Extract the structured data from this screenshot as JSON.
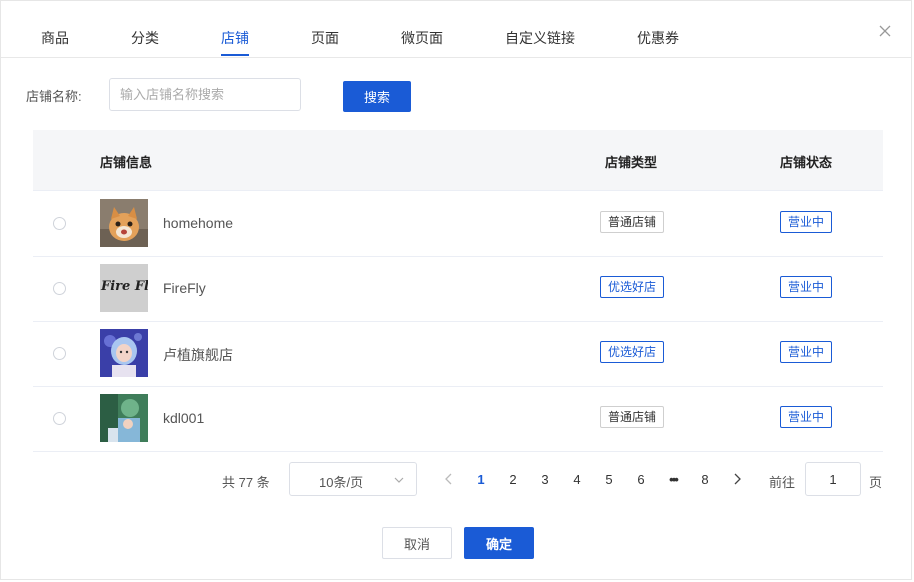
{
  "tabs": [
    {
      "label": "商品",
      "active": false
    },
    {
      "label": "分类",
      "active": false
    },
    {
      "label": "店铺",
      "active": true
    },
    {
      "label": "页面",
      "active": false
    },
    {
      "label": "微页面",
      "active": false
    },
    {
      "label": "自定义链接",
      "active": false
    },
    {
      "label": "优惠券",
      "active": false
    }
  ],
  "search": {
    "label": "店铺名称:",
    "placeholder": "输入店铺名称搜索",
    "value": "",
    "button_label": "搜索"
  },
  "table": {
    "headers": {
      "info": "店铺信息",
      "type": "店铺类型",
      "status": "店铺状态"
    },
    "rows": [
      {
        "name": "homehome",
        "type": "普通店铺",
        "type_kind": "normal",
        "status": "营业中",
        "thumb": "cat-photo"
      },
      {
        "name": "FireFly",
        "type": "优选好店",
        "type_kind": "featured",
        "status": "营业中",
        "thumb": "fire-fly-logo",
        "thumb_text": "Fire Fly"
      },
      {
        "name": "卢植旗舰店",
        "type": "优选好店",
        "type_kind": "featured",
        "status": "营业中",
        "thumb": "person-photo"
      },
      {
        "name": "kdl001",
        "type": "普通店铺",
        "type_kind": "normal",
        "status": "营业中",
        "thumb": "illustration-photo"
      }
    ]
  },
  "pagination": {
    "total_text": "共 77 条",
    "page_size_label": "10条/页",
    "pages": [
      "1",
      "2",
      "3",
      "4",
      "5",
      "6",
      "•••",
      "8"
    ],
    "current_page": "1",
    "goto_label": "前往",
    "goto_value": "1",
    "page_unit": "页"
  },
  "footer": {
    "cancel_label": "取消",
    "ok_label": "确定"
  },
  "colors": {
    "accent": "#1a5bd6",
    "border": "#dcdfe6",
    "header_bg": "#f5f6f8"
  }
}
